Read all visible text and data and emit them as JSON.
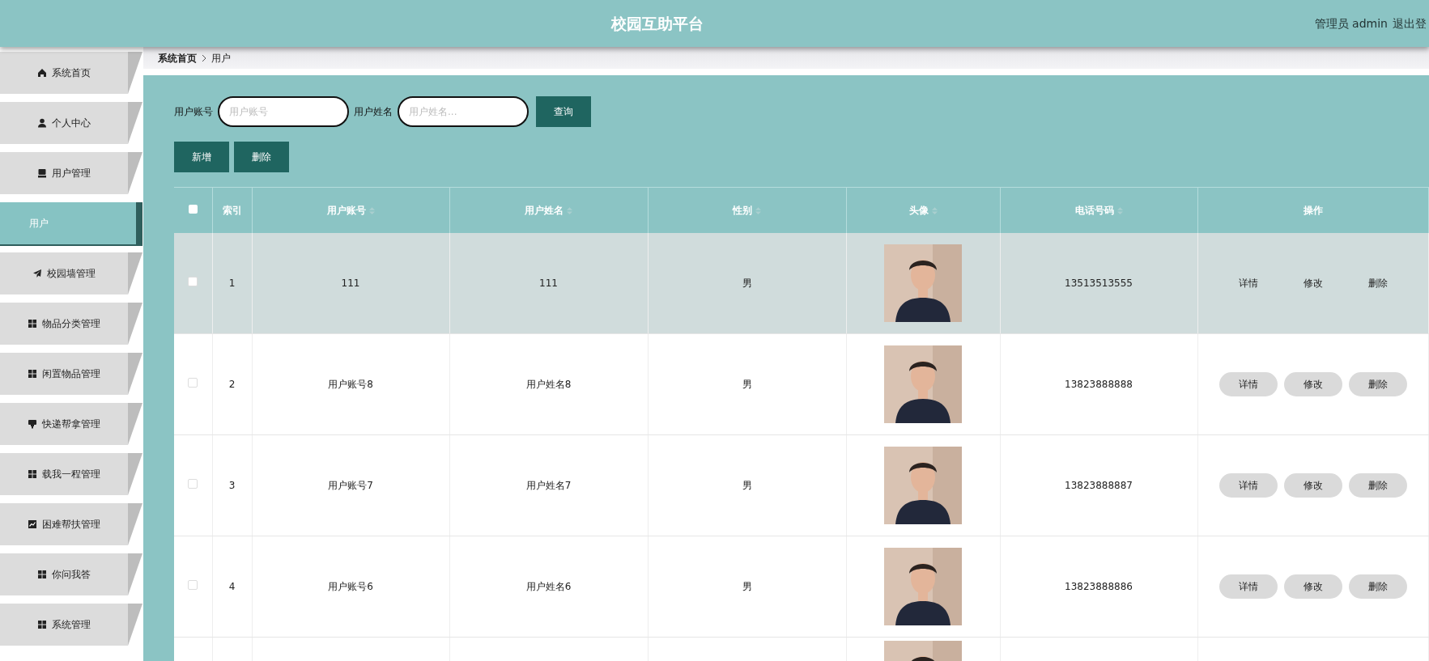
{
  "header": {
    "title": "校园互助平台",
    "user_role": "管理员",
    "user_name": "admin",
    "logout": "退出登"
  },
  "sidebar": {
    "items": [
      {
        "label": "系统首页",
        "selected": false
      },
      {
        "label": "个人中心",
        "selected": false
      },
      {
        "label": "用户管理",
        "selected": false,
        "children": [
          {
            "label": "用户",
            "selected": true
          }
        ]
      },
      {
        "label": "校园墙管理",
        "selected": false
      },
      {
        "label": "物品分类管理",
        "selected": false
      },
      {
        "label": "闲置物品管理",
        "selected": false
      },
      {
        "label": "快递帮拿管理",
        "selected": false
      },
      {
        "label": "载我一程管理",
        "selected": false
      },
      {
        "label": "困难帮扶管理",
        "selected": false
      },
      {
        "label": "你问我答",
        "selected": false
      },
      {
        "label": "系统管理",
        "selected": false
      }
    ]
  },
  "breadcrumb": [
    "系统首页",
    "用户"
  ],
  "search": {
    "fields": [
      {
        "label": "用户账号",
        "placeholder": "用户账号"
      },
      {
        "label": "用户姓名",
        "placeholder": "用户姓名..."
      }
    ],
    "button": "查询"
  },
  "actions": [
    "新增",
    "删除"
  ],
  "table": {
    "select_all_checked": false,
    "columns": [
      {
        "label": "索引",
        "sortable": false
      },
      {
        "label": "用户账号",
        "sortable": true
      },
      {
        "label": "用户姓名",
        "sortable": true
      },
      {
        "label": "性别",
        "sortable": true
      },
      {
        "label": "头像",
        "sortable": true
      },
      {
        "label": "电话号码",
        "sortable": true
      },
      {
        "label": "操作",
        "sortable": false
      }
    ],
    "rows": [
      {
        "kind": "full",
        "index": "1",
        "account": "111",
        "name": "111",
        "gender": "男",
        "phone": "13513513555",
        "actions": [
          "详情",
          "修改",
          "删除"
        ],
        "checked": false,
        "highlighted": true
      },
      {
        "kind": "full",
        "index": "2",
        "account": "用户账号8",
        "name": "用户姓名8",
        "gender": "男",
        "phone": "13823888888",
        "actions": [
          "详情",
          "修改",
          "删除"
        ],
        "checked": false,
        "highlighted": false
      },
      {
        "kind": "full",
        "index": "3",
        "account": "用户账号7",
        "name": "用户姓名7",
        "gender": "男",
        "phone": "13823888887",
        "actions": [
          "详情",
          "修改",
          "删除"
        ],
        "checked": false,
        "highlighted": false
      },
      {
        "kind": "full",
        "index": "4",
        "account": "用户账号6",
        "name": "用户姓名6",
        "gender": "男",
        "phone": "13823888886",
        "actions": [
          "详情",
          "修改",
          "删除"
        ],
        "checked": false,
        "highlighted": false
      },
      {
        "kind": "cut_off"
      }
    ]
  }
}
